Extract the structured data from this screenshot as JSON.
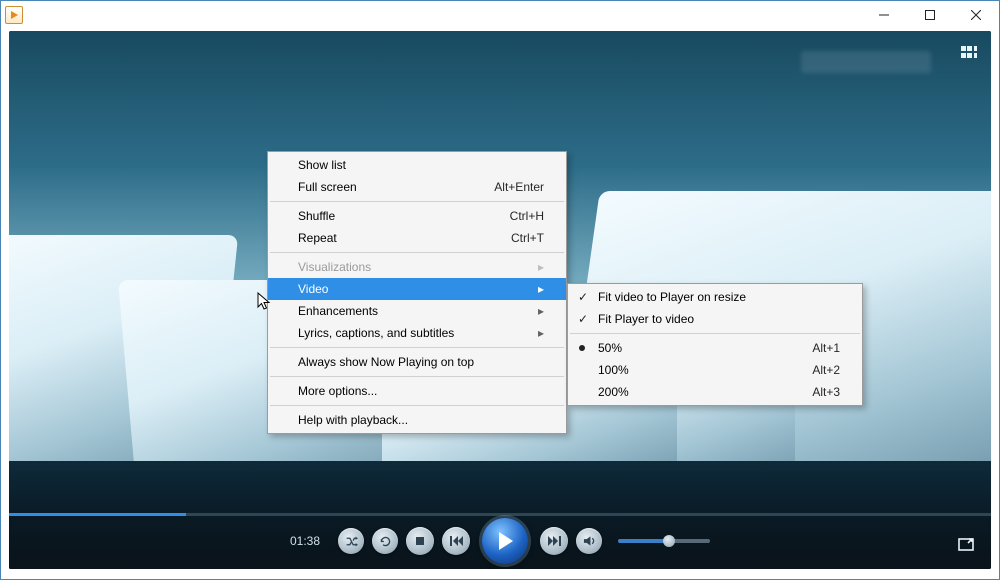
{
  "videoLabel": "",
  "time": "01:38",
  "menu": {
    "showList": "Show list",
    "fullScreen": {
      "label": "Full screen",
      "accel": "Alt+Enter"
    },
    "shuffle": {
      "label": "Shuffle",
      "accel": "Ctrl+H"
    },
    "repeat": {
      "label": "Repeat",
      "accel": "Ctrl+T"
    },
    "visualizations": "Visualizations",
    "video": "Video",
    "enhancements": "Enhancements",
    "lyrics": "Lyrics, captions, and subtitles",
    "alwaysTop": "Always show Now Playing on top",
    "moreOptions": "More options...",
    "help": "Help with playback..."
  },
  "submenu": {
    "fitOnResize": "Fit video to Player on resize",
    "fitPlayer": "Fit Player to video",
    "p50": {
      "label": "50%",
      "accel": "Alt+1"
    },
    "p100": {
      "label": "100%",
      "accel": "Alt+2"
    },
    "p200": {
      "label": "200%",
      "accel": "Alt+3"
    }
  }
}
